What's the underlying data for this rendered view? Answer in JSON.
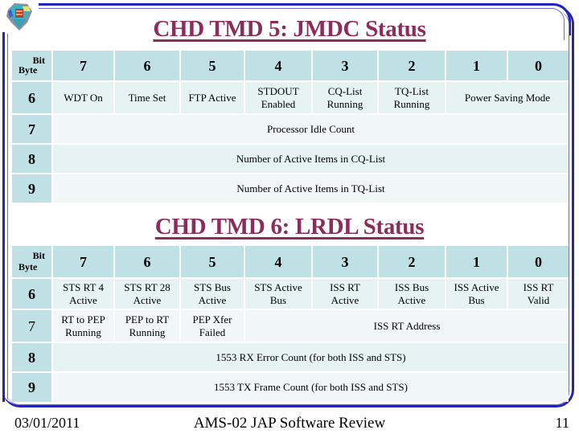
{
  "slide": {
    "logo_icon": "spacecraft-module-icon",
    "accent_color": "#8b2d5c",
    "frame_color": "#2424b8",
    "header_cell_color": "#bfe0e4"
  },
  "table1": {
    "title": "CHD TMD 5: JMDC Status",
    "corner": {
      "bit": "Bit",
      "byte": "Byte"
    },
    "bits": [
      "7",
      "6",
      "5",
      "4",
      "3",
      "2",
      "1",
      "0"
    ],
    "rows": [
      {
        "byte": "6",
        "cells": [
          {
            "text": "WDT On"
          },
          {
            "text": "Time Set"
          },
          {
            "text": "FTP Active"
          },
          {
            "text": "STDOUT Enabled"
          },
          {
            "text": "CQ-List Running"
          },
          {
            "text": "TQ-List Running"
          },
          {
            "text": "Power Saving Mode"
          }
        ]
      },
      {
        "byte": "7",
        "cells": [
          {
            "text": "Processor Idle Count"
          }
        ]
      },
      {
        "byte": "8",
        "cells": [
          {
            "text": "Number of Active Items in CQ-List"
          }
        ]
      },
      {
        "byte": "9",
        "cells": [
          {
            "text": "Number of Active Items in TQ-List"
          }
        ]
      }
    ]
  },
  "table2": {
    "title": "CHD TMD 6: LRDL Status",
    "corner": {
      "bit": "Bit",
      "byte": "Byte"
    },
    "bits": [
      "7",
      "6",
      "5",
      "4",
      "3",
      "2",
      "1",
      "0"
    ],
    "rows": [
      {
        "byte": "6",
        "cells": [
          {
            "text": "STS RT 4 Active"
          },
          {
            "text": "STS RT 28 Active"
          },
          {
            "text": "STS Bus Active"
          },
          {
            "text": "STS Active Bus"
          },
          {
            "text": "ISS RT Active"
          },
          {
            "text": "ISS Bus Active"
          },
          {
            "text": "ISS Active Bus"
          },
          {
            "text": "ISS RT Valid"
          }
        ]
      },
      {
        "byte": "7",
        "cells": [
          {
            "text": "RT to PEP Running"
          },
          {
            "text": "PEP to RT Running"
          },
          {
            "text": "PEP Xfer Failed"
          },
          {
            "text": "ISS RT Address"
          }
        ]
      },
      {
        "byte": "8",
        "cells": [
          {
            "text": "1553 RX Error Count (for both ISS and STS)"
          }
        ]
      },
      {
        "byte": "9",
        "cells": [
          {
            "text": "1553 TX Frame Count (for both ISS and STS)"
          }
        ]
      }
    ]
  },
  "footer": {
    "date": "03/01/2011",
    "center": "AMS-02 JAP Software Review",
    "page": "11"
  }
}
